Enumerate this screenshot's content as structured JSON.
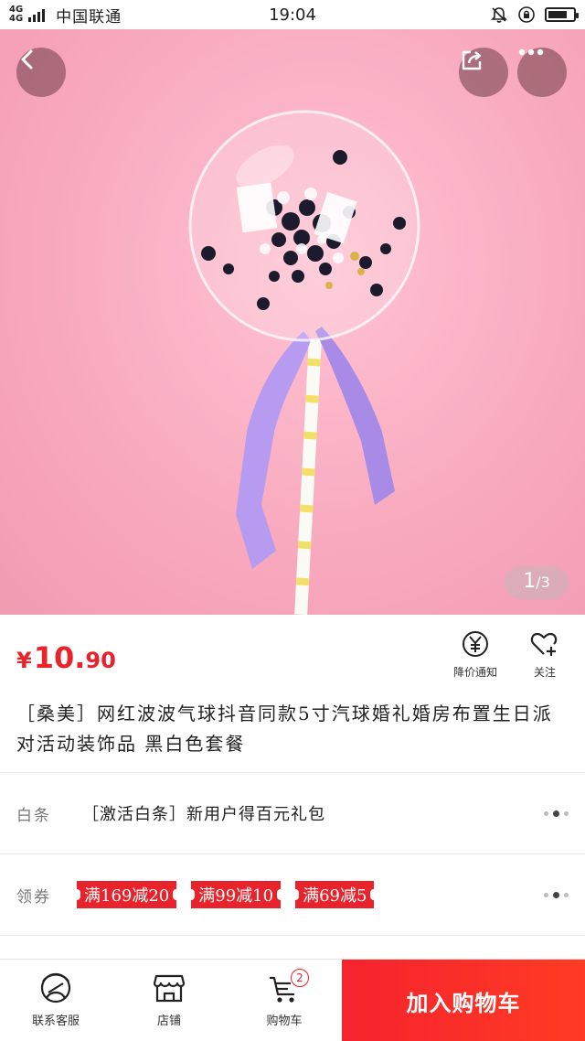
{
  "status_bar": {
    "network": "4G",
    "network2": "4G",
    "carrier": "中国联通",
    "time": "19:04"
  },
  "gallery": {
    "current": "1",
    "total": "/3",
    "icons": {
      "back": "chevron-left-icon",
      "share": "share-icon",
      "more": "more-dots-icon"
    }
  },
  "product": {
    "price_symbol": "¥",
    "price_int": "10.",
    "price_dec": "90",
    "title": "［桑美］网红波波气球抖音同款5寸汽球婚礼婚房布置生日派对活动装饰品 黑白色套餐",
    "price_color": "#e8232b"
  },
  "actions": {
    "notify_label": "降价通知",
    "follow_label": "关注"
  },
  "rows": {
    "baitiao_label": "白条",
    "baitiao_text": "［激活白条］新用户得百元礼包",
    "coupon_label": "领券",
    "coupons": [
      "满169减20",
      "满99减10",
      "满69减5"
    ]
  },
  "bottom_bar": {
    "service_label": "联系客服",
    "shop_label": "店铺",
    "cart_label": "购物车",
    "cart_count": "2",
    "add_to_cart": "加入购物车",
    "accent_color": "#f5232d"
  }
}
